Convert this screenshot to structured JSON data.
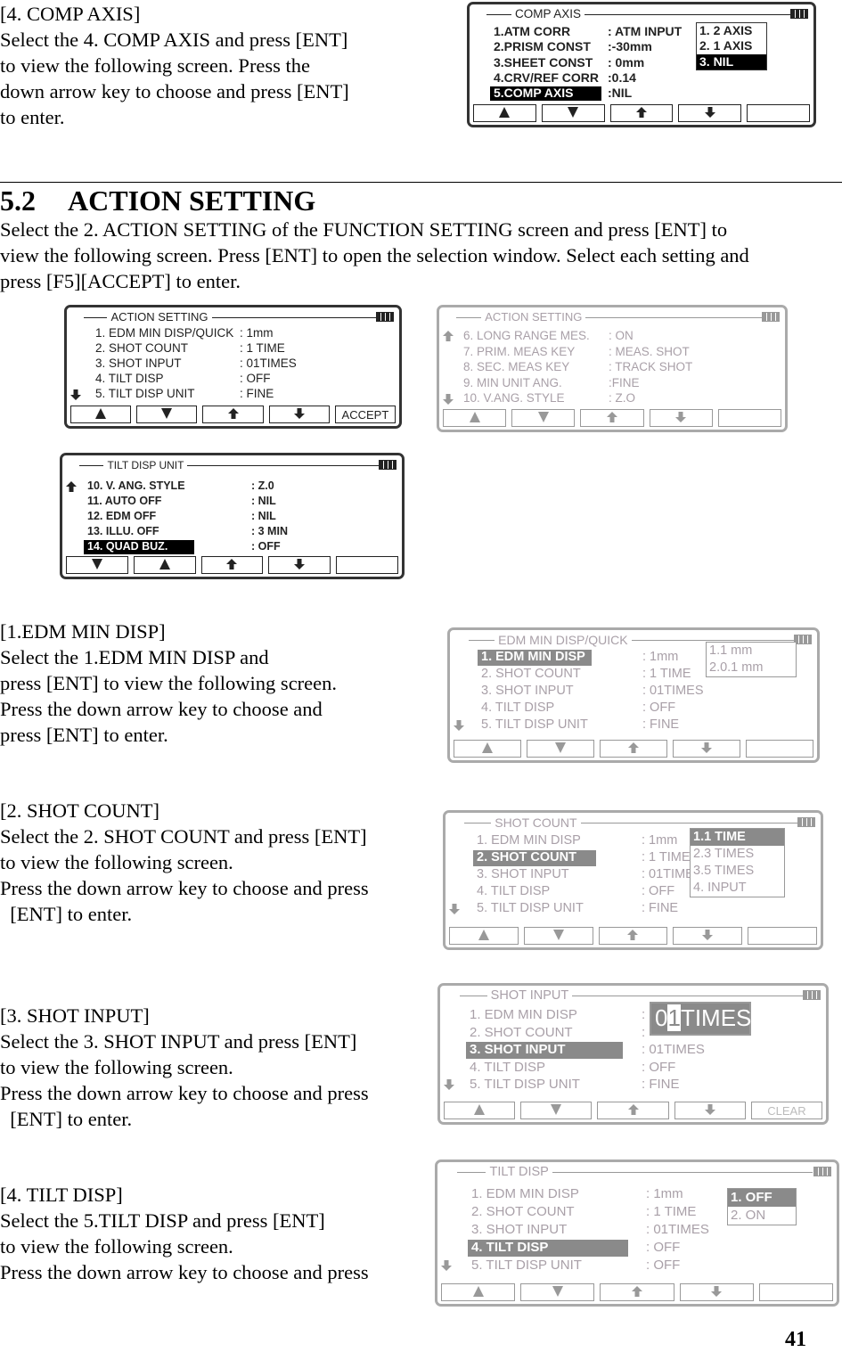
{
  "comp_axis_instructions": [
    "[4. COMP AXIS]",
    "Select the 4. COMP AXIS and press [ENT]",
    "to view the following screen. Press the",
    "down arrow key to choose and press [ENT]",
    "to enter."
  ],
  "section": {
    "number": "5.2",
    "title": "ACTION SETTING"
  },
  "intro": [
    "Select the 2. ACTION SETTING of the FUNCTION SETTING screen and press [ENT] to",
    "view the following screen. Press [ENT] to open the selection window. Select each setting and",
    "press [F5][ACCEPT] to enter."
  ],
  "edm_instructions": [
    "[1.EDM MIN DISP]",
    "Select the 1.EDM MIN DISP and",
    "press [ENT] to view the following screen.",
    "Press the down arrow key to choose and",
    "press [ENT] to enter."
  ],
  "shot_count_instructions": [
    "[2. SHOT COUNT]",
    "Select the 2. SHOT COUNT and press [ENT]",
    "to view the following screen.",
    "Press the down arrow key to choose and press",
    "  [ENT] to enter."
  ],
  "shot_input_instructions": [
    "[3. SHOT INPUT]",
    "Select the 3. SHOT INPUT and press [ENT]",
    "to view the following screen.",
    "Press the down arrow key to choose and press",
    "  [ENT] to enter."
  ],
  "tilt_instructions": [
    "[4. TILT DISP]",
    "Select the 5.TILT DISP and press [ENT]",
    "to view the following screen.",
    "Press the down arrow key to choose and press"
  ],
  "page_number": "41",
  "screens": [
    {
      "title": "COMP AXIS",
      "style": "dark",
      "scroll_up": false,
      "scroll_down": false,
      "rows": [
        {
          "label": "1.ATM CORR",
          "value": ": ATM INPUT"
        },
        {
          "label": "2.PRISM CONST",
          "value": ":-30mm"
        },
        {
          "label": "3.SHEET CONST",
          "value": ":   0mm"
        },
        {
          "label": "4.CRV/REF CORR",
          "value": ":0.14"
        },
        {
          "label": "5.COMP AXIS",
          "value": ":NIL",
          "selected": true
        }
      ],
      "popup": {
        "items": [
          "1. 2 AXIS",
          "2. 1 AXIS",
          "3. NIL"
        ],
        "selected": 2
      },
      "softkeys": [
        "triangle-up",
        "triangle-down",
        "page-up",
        "page-down",
        ""
      ]
    },
    {
      "title": "ACTION SETTING",
      "style": "dark",
      "scroll_up": false,
      "scroll_down": true,
      "rows": [
        {
          "label": "1. EDM MIN DISP/QUICK",
          "value": ": 1mm"
        },
        {
          "label": "2. SHOT COUNT",
          "value": ": 1 TIME"
        },
        {
          "label": "3. SHOT INPUT",
          "value": ": 01TIMES"
        },
        {
          "label": "4. TILT DISP",
          "value": ": OFF"
        },
        {
          "label": "5. TILT DISP UNIT",
          "value": ": FINE"
        }
      ],
      "softkeys": [
        "triangle-up",
        "triangle-down",
        "page-up",
        "page-down",
        "ACCEPT"
      ]
    },
    {
      "title": "ACTION SETTING",
      "style": "gray",
      "scroll_up": true,
      "scroll_down": true,
      "rows": [
        {
          "label": "6. LONG RANGE MES.",
          "value": ": ON"
        },
        {
          "label": "7. PRIM. MEAS KEY",
          "value": ": MEAS. SHOT"
        },
        {
          "label": "8. SEC. MEAS KEY",
          "value": ": TRACK SHOT"
        },
        {
          "label": "9. MIN UNIT ANG.",
          "value": ":FINE"
        },
        {
          "label": "10. V.ANG. STYLE",
          "value": ": Z.O"
        }
      ],
      "softkeys": [
        "triangle-up",
        "triangle-down",
        "page-up",
        "page-down",
        ""
      ]
    },
    {
      "title": "TILT DISP UNIT",
      "style": "dark",
      "scroll_up": true,
      "scroll_down": false,
      "rows": [
        {
          "label": "10. V. ANG. STYLE",
          "value": ":  Z.0"
        },
        {
          "label": "11. AUTO OFF",
          "value": ":  NIL"
        },
        {
          "label": "12. EDM OFF",
          "value": ":  NIL"
        },
        {
          "label": "13. ILLU. OFF",
          "value": ":  3 MIN"
        },
        {
          "label": "14. QUAD BUZ.",
          "value": ":  OFF",
          "selected": true
        }
      ],
      "softkeys": [
        "triangle-down",
        "triangle-up",
        "page-up",
        "page-down",
        ""
      ]
    },
    {
      "title": "EDM MIN DISP/QUICK",
      "style": "gray",
      "scroll_up": false,
      "scroll_down": true,
      "rows": [
        {
          "label": "1. EDM MIN DISP",
          "value": ": 1mm",
          "selected": true
        },
        {
          "label": "2. SHOT COUNT",
          "value": ": 1 TIME"
        },
        {
          "label": "3. SHOT INPUT",
          "value": ": 01TIMES"
        },
        {
          "label": "4. TILT DISP",
          "value": ": OFF"
        },
        {
          "label": "5. TILT DISP UNIT",
          "value": ": FINE"
        }
      ],
      "popup": {
        "items": [
          "1.1 mm",
          "2.0.1 mm"
        ],
        "selected": -1
      },
      "softkeys": [
        "triangle-up",
        "triangle-down",
        "page-up",
        "page-down",
        ""
      ]
    },
    {
      "title": "SHOT COUNT",
      "style": "gray",
      "scroll_up": false,
      "scroll_down": true,
      "rows": [
        {
          "label": "1. EDM MIN DISP",
          "value": ": 1mm"
        },
        {
          "label": "2. SHOT COUNT",
          "value": ": 1 TIME",
          "selected": true
        },
        {
          "label": "3. SHOT INPUT",
          "value": ": 01TIMES"
        },
        {
          "label": "4. TILT DISP",
          "value": ": OFF"
        },
        {
          "label": "5. TILT DISP UNIT",
          "value": ": FINE"
        }
      ],
      "popup": {
        "items": [
          "1.1 TIME",
          "2.3 TIMES",
          "3.5 TIMES",
          "4. INPUT"
        ],
        "selected": 0
      },
      "softkeys": [
        "triangle-up",
        "triangle-down",
        "page-up",
        "page-down",
        ""
      ]
    },
    {
      "title": "SHOT INPUT",
      "style": "gray",
      "scroll_up": false,
      "scroll_down": true,
      "rows": [
        {
          "label": "1. EDM MIN DISP",
          "value": ":"
        },
        {
          "label": "2. SHOT COUNT",
          "value": ":"
        },
        {
          "label": "3. SHOT INPUT",
          "value": ": 01TIMES",
          "selected": true
        },
        {
          "label": "4. TILT DISP",
          "value": ": OFF"
        },
        {
          "label": "5. TILT DISP UNIT",
          "value": ": FINE"
        }
      ],
      "input": {
        "before": "0",
        "cursor": "1",
        "after": "TIMES"
      },
      "softkeys": [
        "triangle-up",
        "triangle-down",
        "page-up",
        "page-down",
        "CLEAR"
      ]
    },
    {
      "title": "TILT DISP",
      "style": "gray",
      "scroll_up": false,
      "scroll_down": true,
      "rows": [
        {
          "label": "1. EDM MIN DISP",
          "value": ": 1mm"
        },
        {
          "label": "2. SHOT COUNT",
          "value": ": 1 TIME"
        },
        {
          "label": "3. SHOT INPUT",
          "value": ": 01TIMES"
        },
        {
          "label": "4. TILT DISP",
          "value": ": OFF",
          "selected": true
        },
        {
          "label": "5. TILT DISP UNIT",
          "value": ": OFF"
        }
      ],
      "popup": {
        "items": [
          "1. OFF",
          "2. ON"
        ],
        "selected": 0
      },
      "softkeys": [
        "triangle-up",
        "triangle-down",
        "page-up",
        "page-down",
        ""
      ]
    }
  ]
}
